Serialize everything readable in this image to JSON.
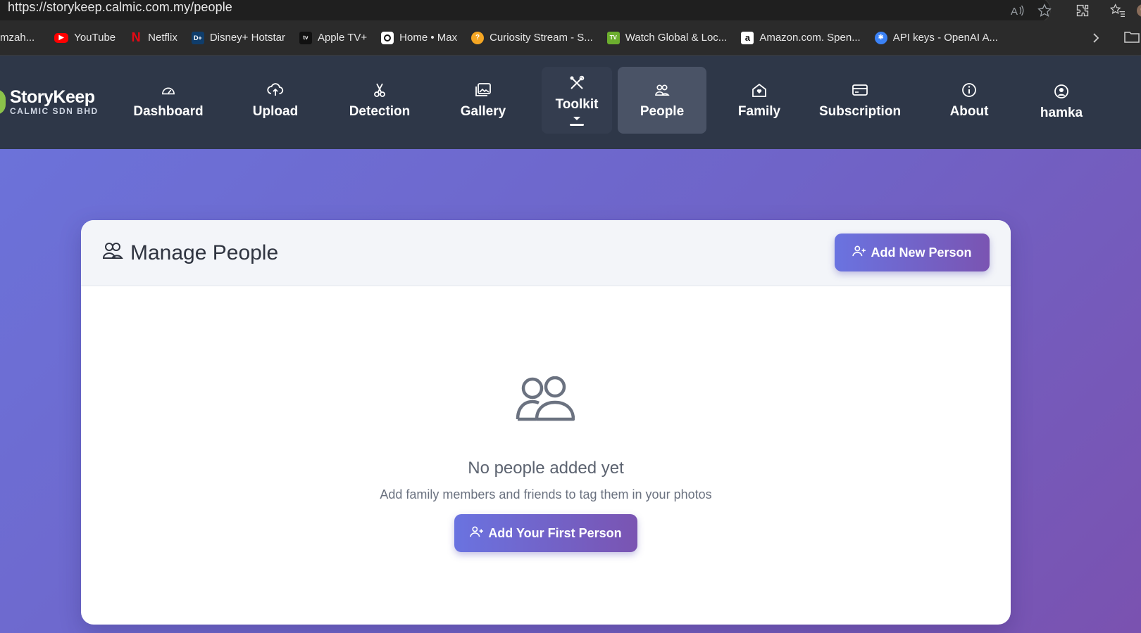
{
  "browser": {
    "url": "https://storykeep.calmic.com.my/people",
    "bookmarks": [
      {
        "label": "mzah...",
        "icon": "generic-favicon-icon",
        "color": "#5a5a5a"
      },
      {
        "label": "YouTube",
        "icon": "youtube-icon",
        "color": "#ff0000"
      },
      {
        "label": "Netflix",
        "icon": "netflix-icon",
        "color": "#e50914"
      },
      {
        "label": "Disney+ Hotstar",
        "icon": "hotstar-icon",
        "color": "#0f3d6b"
      },
      {
        "label": "Apple TV+",
        "icon": "appletv-icon",
        "color": "#111111"
      },
      {
        "label": "Home • Max",
        "icon": "max-icon",
        "color": "#111111"
      },
      {
        "label": "Curiosity Stream - S...",
        "icon": "curiosity-icon",
        "color": "#f5a623"
      },
      {
        "label": "Watch Global & Loc...",
        "icon": "tv-icon",
        "color": "#6cae2e"
      },
      {
        "label": "Amazon.com. Spen...",
        "icon": "amazon-icon",
        "color": "#ffffff"
      },
      {
        "label": "API keys - OpenAI A...",
        "icon": "openai-icon",
        "color": "#3b82f6"
      }
    ]
  },
  "brand": {
    "name": "StoryKeep",
    "subtitle": "CALMIC SDN BHD"
  },
  "nav": {
    "dashboard": "Dashboard",
    "upload": "Upload",
    "detection": "Detection",
    "gallery": "Gallery",
    "toolkit": "Toolkit",
    "people": "People",
    "family": "Family",
    "subscription": "Subscription",
    "about": "About",
    "user": "hamka",
    "active": "People"
  },
  "page": {
    "title": "Manage People",
    "add_button": "Add New Person",
    "empty_title": "No people added yet",
    "empty_subtitle": "Add family members and friends to tag them in your photos",
    "empty_button": "Add Your First Person"
  },
  "colors": {
    "nav_bg": "#2e3748",
    "accent_start": "#6a73e0",
    "accent_end": "#7a54b2",
    "brand_green": "#8bc34a"
  }
}
